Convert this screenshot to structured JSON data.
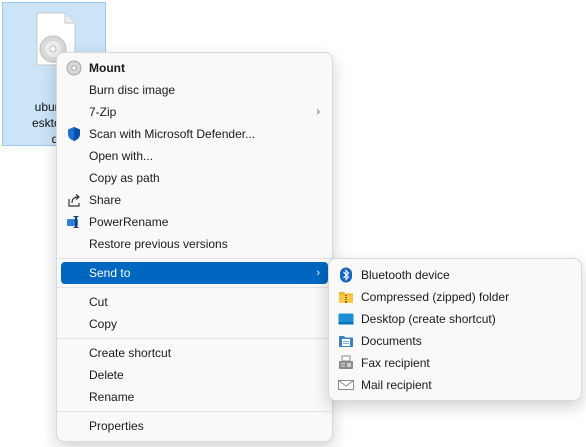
{
  "desktop": {
    "file_name": "ubuntu-\nesktop-a\nd",
    "file_icon": "disc-image-file-icon"
  },
  "context_menu": {
    "groups": [
      [
        {
          "label": "Mount",
          "icon": "disc-icon",
          "bold": true
        },
        {
          "label": "Burn disc image"
        },
        {
          "label": "7-Zip",
          "submenu": true
        },
        {
          "label": "Scan with Microsoft Defender...",
          "icon": "defender-shield-icon"
        },
        {
          "label": "Open with..."
        },
        {
          "label": "Copy as path"
        },
        {
          "label": "Share",
          "icon": "share-icon"
        },
        {
          "label": "PowerRename",
          "icon": "powerrename-icon"
        },
        {
          "label": "Restore previous versions"
        }
      ],
      [
        {
          "label": "Send to",
          "submenu": true,
          "selected": true
        }
      ],
      [
        {
          "label": "Cut"
        },
        {
          "label": "Copy"
        }
      ],
      [
        {
          "label": "Create shortcut"
        },
        {
          "label": "Delete"
        },
        {
          "label": "Rename"
        }
      ],
      [
        {
          "label": "Properties"
        }
      ]
    ],
    "submenu_arrow": "›"
  },
  "send_to_menu": {
    "items": [
      {
        "label": "Bluetooth device",
        "icon": "bluetooth-icon"
      },
      {
        "label": "Compressed (zipped) folder",
        "icon": "zip-folder-icon"
      },
      {
        "label": "Desktop (create shortcut)",
        "icon": "desktop-icon"
      },
      {
        "label": "Documents",
        "icon": "documents-icon"
      },
      {
        "label": "Fax recipient",
        "icon": "fax-icon"
      },
      {
        "label": "Mail recipient",
        "icon": "mail-icon"
      }
    ]
  },
  "colors": {
    "selection": "#0067c0",
    "tile_selection": "#cce4f7",
    "menu_bg": "#f9f9f9"
  }
}
